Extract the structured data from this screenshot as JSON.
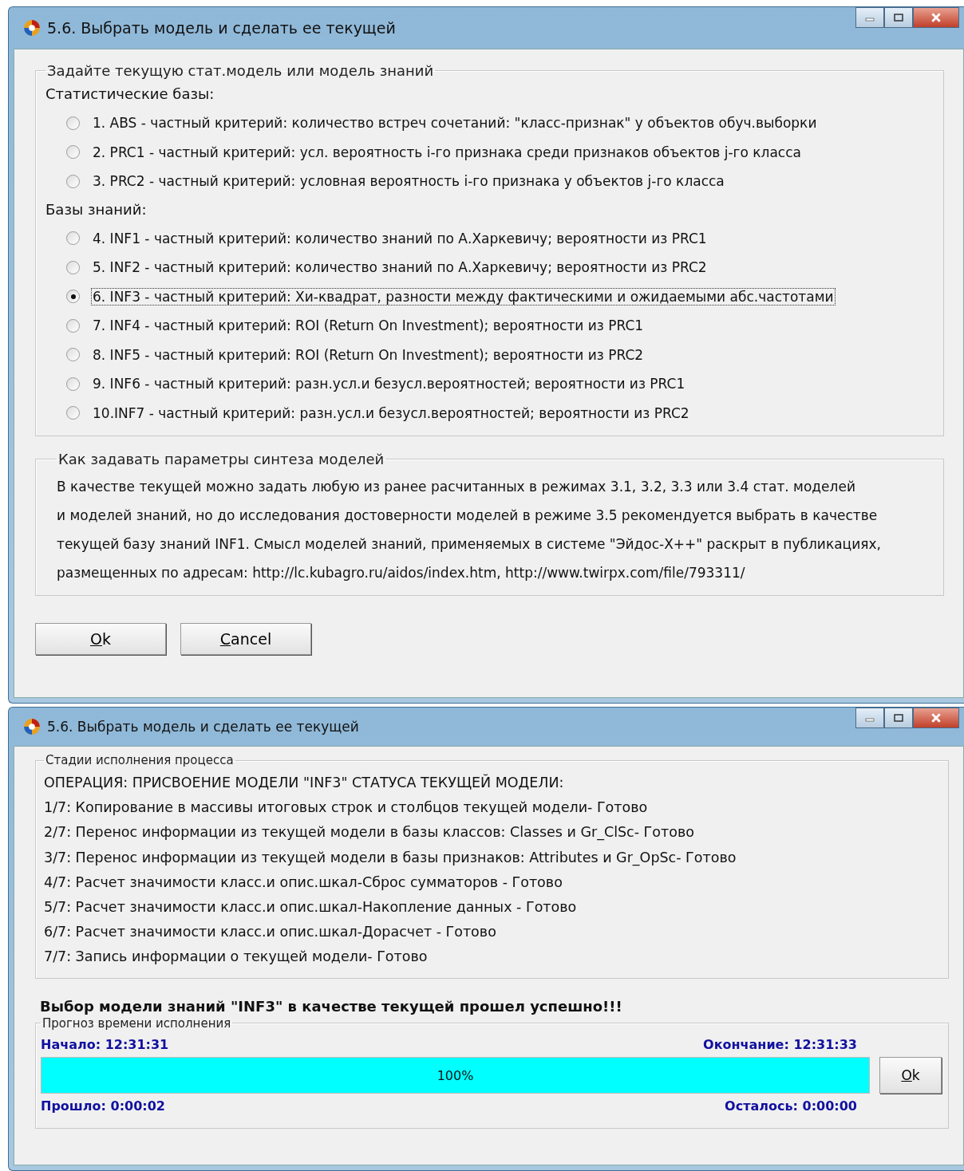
{
  "windows": [
    {
      "kind": "select",
      "title": "5.6. Выбрать модель и сделать ее текущей",
      "model_group": {
        "title": "Задайте текущую стат.модель или модель знаний",
        "sections": [
          {
            "heading": "Статистические базы:",
            "options": [
              {
                "label": "1. ABS  - частный критерий: количество встреч сочетаний: \"класс-признак\" у объектов обуч.выборки",
                "selected": false
              },
              {
                "label": "2. PRC1 - частный критерий: усл. вероятность i-го признака среди признаков объектов j-го класса",
                "selected": false
              },
              {
                "label": "3. PRC2 - частный критерий: условная вероятность i-го признака у объектов j-го класса",
                "selected": false
              }
            ]
          },
          {
            "heading": "Базы знаний:",
            "options": [
              {
                "label": "4. INF1 - частный критерий: количество знаний по А.Харкевичу; вероятности из PRC1",
                "selected": false
              },
              {
                "label": "5. INF2 - частный критерий: количество знаний по А.Харкевичу; вероятности из PRC2",
                "selected": false
              },
              {
                "label": "6. INF3 - частный критерий: Хи-квадрат, разности между фактическими и ожидаемыми абс.частотами",
                "selected": true
              },
              {
                "label": "7. INF4 - частный критерий: ROI (Return On Investment); вероятности из PRC1",
                "selected": false
              },
              {
                "label": "8. INF5 - частный критерий: ROI (Return On Investment); вероятности из PRC2",
                "selected": false
              },
              {
                "label": "9. INF6 - частный критерий: разн.усл.и безусл.вероятностей; вероятности из PRC1",
                "selected": false
              },
              {
                "label": "10.INF7 - частный критерий: разн.усл.и безусл.вероятностей; вероятности из PRC2",
                "selected": false
              }
            ]
          }
        ]
      },
      "help_group": {
        "title": "Как задавать параметры синтеза моделей",
        "lines": [
          "В качестве текущей можно задать любую из ранее расчитанных в режимах 3.1, 3.2, 3.3 или 3.4 стат. моделей",
          "и моделей знаний, но до исследования достоверности моделей в режиме 3.5 рекомендуется выбрать в качестве",
          "текущей базу знаний INF1. Смысл моделей знаний, применяемых в системе \"Эйдос-Х++\" раскрыт в публикациях,",
          "размещенных по адресам: http://lc.kubagro.ru/aidos/index.htm, http://www.twirpx.com/file/793311/"
        ]
      },
      "buttons": [
        "Ok",
        "Cancel"
      ]
    },
    {
      "kind": "progress",
      "title": "5.6. Выбрать модель и сделать ее текущей",
      "stages_group": {
        "title": "Стадии исполнения процесса",
        "lines": [
          "ОПЕРАЦИЯ: ПРИСВОЕНИЕ МОДЕЛИ \"INF3\" СТАТУСА ТЕКУЩЕЙ МОДЕЛИ:",
          "1/7: Копирование в массивы итоговых строк и столбцов текущей модели- Готово",
          "2/7: Перенос информации из текущей модели в базы классов:   Classes    и Gr_ClSc- Готово",
          "3/7: Перенос информации из текущей модели в базы признаков: Attributes и Gr_OpSc- Готово",
          "4/7: Расчет значимости класс.и опис.шкал-Сброс сумматоров - Готово",
          "5/7: Расчет значимости класс.и опис.шкал-Накопление данных - Готово",
          "6/7: Расчет значимости класс.и опис.шкал-Дорасчет - Готово",
          "7/7: Запись информации о текущей модели- Готово"
        ]
      },
      "result": "Выбор модели знаний \"INF3\" в качестве текущей прошел успешно!!!",
      "timing_group": {
        "title": "Прогноз времени исполнения",
        "start": "Начало: 12:31:31",
        "end": "Окончание: 12:31:33",
        "level": 1.0,
        "percent": "100%",
        "elapsed": "Прошло: 0:00:02",
        "remaining": "Осталось: 0:00:00",
        "button": "Ok"
      }
    }
  ]
}
